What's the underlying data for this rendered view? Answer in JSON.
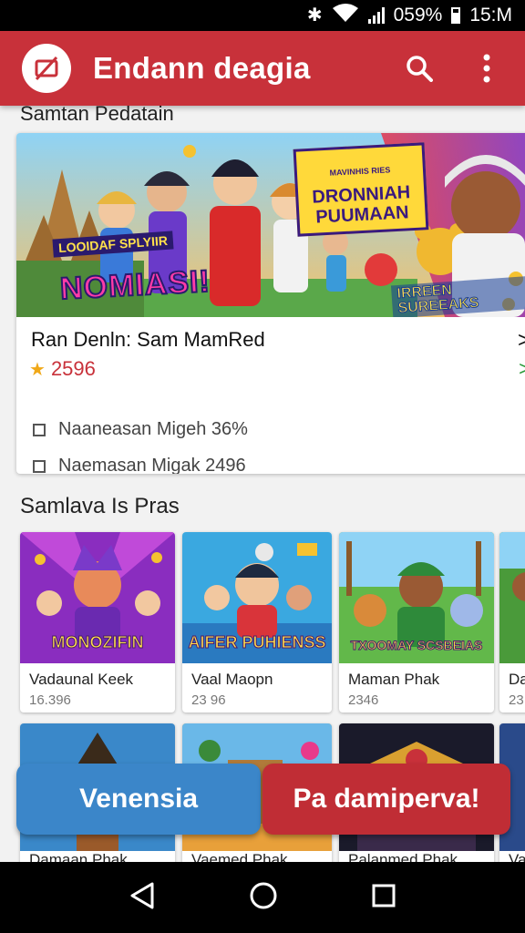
{
  "status_bar": {
    "battery": "059%",
    "time": "15:M"
  },
  "app_bar": {
    "title": "Endann deagia",
    "logo_icon": "no-image-icon",
    "search_icon": "search-icon",
    "menu_icon": "more-vert-icon"
  },
  "featured": {
    "section_title": "Samtan Pedatain",
    "banner_left_text": "NOMIASI!",
    "banner_left_tag": "LOOIDAF SPLYIIR",
    "banner_right_small": "MAVINHIS RIES",
    "banner_right_text": "DRONNIAH PUUMAAN",
    "banner_badge": "IRREEN SUREEAKS",
    "title": "Ran Denln: Sam MamRed",
    "rating": "2596",
    "items": [
      {
        "label": "Naaneasan Migeh 36%"
      },
      {
        "label": "Naemasan Migak 2496"
      }
    ]
  },
  "popular": {
    "section_title": "Samlava Is Pras",
    "row1": [
      {
        "name": "Vadaunal Keek",
        "count": "16.396",
        "art": "MONOZIFIN"
      },
      {
        "name": "Vaal Maopn",
        "count": "23 96",
        "art": "AIFER PUHIENSS"
      },
      {
        "name": "Maman Phak",
        "count": "2346",
        "art": "TXOOMAY SCSBEIAS"
      },
      {
        "name": "Da",
        "count": "23",
        "art": ""
      }
    ],
    "row2": [
      {
        "name": "Damaan Phak"
      },
      {
        "name": "Vaemed Phak"
      },
      {
        "name": "Palanmed Phak"
      },
      {
        "name": "Va"
      }
    ]
  },
  "actions": {
    "primary": "Venensia",
    "secondary": "Pa damiperva!"
  },
  "colors": {
    "app_bar": "#c8313a",
    "cta_blue": "#3b86c9",
    "cta_red": "#c02d35",
    "rating": "#c8313a"
  }
}
